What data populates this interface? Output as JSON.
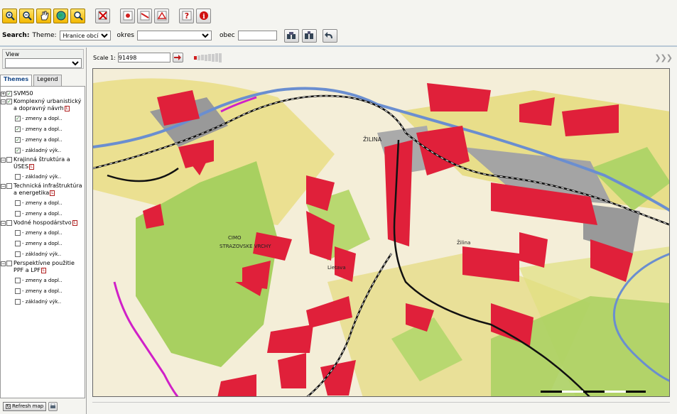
{
  "toolbar": {
    "buttons": [
      {
        "icon": "zoom-in-icon"
      },
      {
        "icon": "zoom-out-icon"
      },
      {
        "icon": "pan-hand-icon"
      },
      {
        "icon": "globe-full-extent-icon"
      },
      {
        "icon": "zoom-select-icon"
      },
      {
        "icon": "clear-selection-icon"
      },
      {
        "icon": "identify-point-icon"
      },
      {
        "icon": "measure-line-icon"
      },
      {
        "icon": "measure-area-icon"
      },
      {
        "icon": "help-icon",
        "glyph": "?"
      },
      {
        "icon": "info-icon",
        "glyph": "i"
      }
    ]
  },
  "search": {
    "label": "Search:",
    "theme_label": "Theme:",
    "theme_value": "Hranice obcí",
    "okres_label": "okres",
    "okres_value": "",
    "obec_label": "obec",
    "obec_value": ""
  },
  "left": {
    "view_label": "View",
    "tabs": [
      "Themes",
      "Legend"
    ],
    "tree": [
      {
        "label": "SVM50",
        "checked": true,
        "expanded": false,
        "children": []
      },
      {
        "label": "Komplexný urbanistický a dopravný návrh",
        "checked": true,
        "expanded": true,
        "legend": true,
        "children": [
          {
            "label": "zmeny a dopl..",
            "checked": true
          },
          {
            "label": "zmeny a dopl..",
            "checked": true
          },
          {
            "label": "zmeny a dopl..",
            "checked": true
          },
          {
            "label": "základný výk..",
            "checked": true
          }
        ]
      },
      {
        "label": "Krajinná štruktúra a ÚSES",
        "checked": false,
        "expanded": true,
        "legend": true,
        "children": [
          {
            "label": "základný výk..",
            "checked": false
          }
        ]
      },
      {
        "label": "Technická infraštruktúra a energetika",
        "checked": false,
        "expanded": true,
        "legend": true,
        "children": [
          {
            "label": "zmeny a dopl..",
            "checked": false
          },
          {
            "label": "zmeny a dopl..",
            "checked": false
          }
        ]
      },
      {
        "label": "Vodné hospodárstvo",
        "checked": false,
        "expanded": true,
        "legend": true,
        "children": [
          {
            "label": "zmeny a dopl..",
            "checked": false
          },
          {
            "label": "zmeny a dopl..",
            "checked": false
          },
          {
            "label": "základný výk..",
            "checked": false
          }
        ]
      },
      {
        "label": "Perspektívne použitie PPF a LPF",
        "checked": false,
        "expanded": true,
        "legend": true,
        "children": [
          {
            "label": "zmeny a dopl..",
            "checked": false
          },
          {
            "label": "zmeny a dopl..",
            "checked": false
          },
          {
            "label": "základný výk..",
            "checked": false
          }
        ]
      }
    ],
    "refresh_label": "Refresh map"
  },
  "scale": {
    "label": "Scale 1:",
    "value": "91498",
    "expand_glyph": "❯❯❯"
  },
  "map": {
    "labels": [
      "CIMO",
      "STRAZOVSKE VRCHY",
      "ŽILINA",
      "Žilina",
      "Lietava"
    ]
  },
  "colors": {
    "accent": "#1b4c8a",
    "urban_red": "#e0203a",
    "forest_green": "#a8d060",
    "field_yellow": "#e8dc80"
  }
}
